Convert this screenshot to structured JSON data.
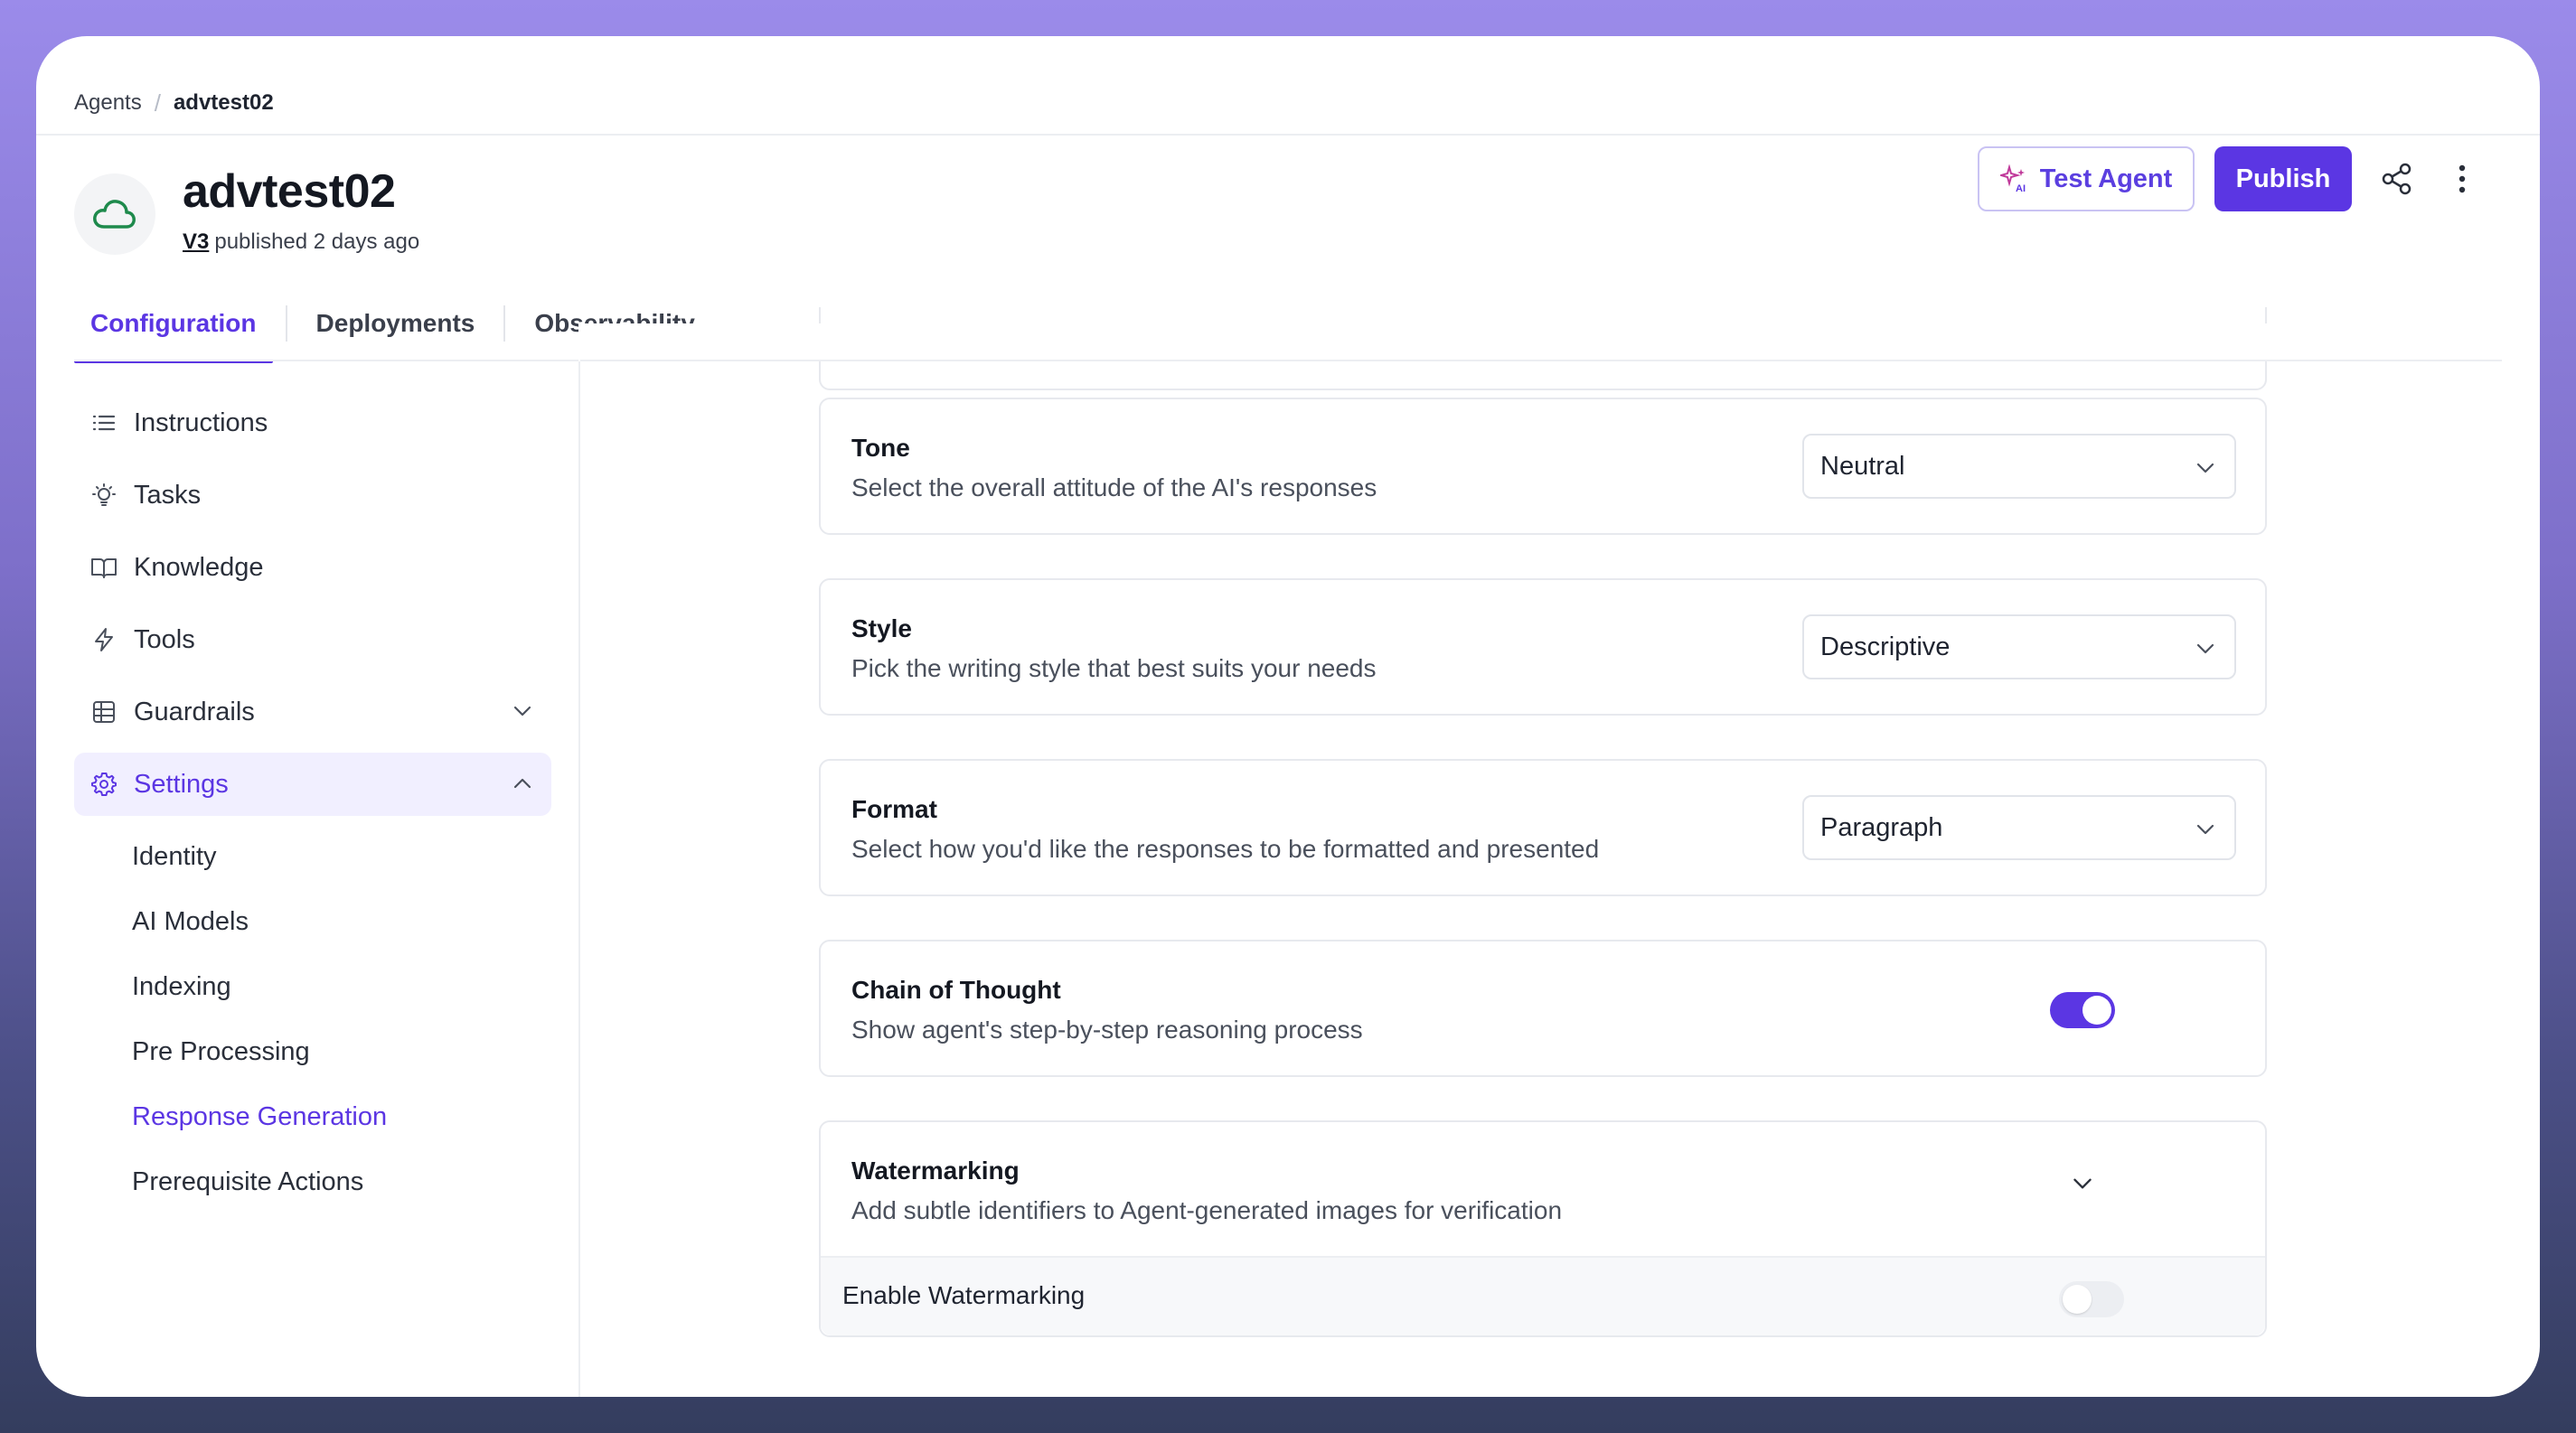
{
  "breadcrumb": {
    "root": "Agents",
    "separator": "/",
    "current": "advtest02"
  },
  "agent": {
    "name": "advtest02",
    "version": "V3",
    "status_text": "published 2 days ago",
    "icon": "cloud-icon"
  },
  "actions": {
    "test_label": "Test Agent",
    "publish_label": "Publish"
  },
  "tabs": [
    {
      "label": "Configuration",
      "active": true
    },
    {
      "label": "Deployments",
      "active": false
    },
    {
      "label": "Observability",
      "active": false
    }
  ],
  "sidebar": {
    "items": [
      {
        "label": "Instructions",
        "icon": "list-icon"
      },
      {
        "label": "Tasks",
        "icon": "lightbulb-icon"
      },
      {
        "label": "Knowledge",
        "icon": "book-icon"
      },
      {
        "label": "Tools",
        "icon": "bolt-icon"
      },
      {
        "label": "Guardrails",
        "icon": "grid-icon"
      },
      {
        "label": "Settings",
        "icon": "gear-icon"
      }
    ],
    "settings_sub": [
      {
        "label": "Identity"
      },
      {
        "label": "AI Models"
      },
      {
        "label": "Indexing"
      },
      {
        "label": "Pre Processing"
      },
      {
        "label": "Response Generation"
      },
      {
        "label": "Prerequisite Actions"
      }
    ]
  },
  "settings": {
    "tone": {
      "title": "Tone",
      "description": "Select the overall attitude of the AI's responses",
      "value": "Neutral"
    },
    "style": {
      "title": "Style",
      "description": "Pick the writing style that best suits your needs",
      "value": "Descriptive"
    },
    "format": {
      "title": "Format",
      "description": "Select how you'd like the responses to be formatted and presented",
      "value": "Paragraph"
    },
    "chain_of_thought": {
      "title": "Chain of Thought",
      "description": "Show agent's step-by-step reasoning process",
      "enabled": true
    },
    "watermarking": {
      "title": "Watermarking",
      "description": "Add subtle identifiers to Agent-generated images for verification",
      "enable_label": "Enable Watermarking",
      "enabled": false
    }
  },
  "colors": {
    "accent": "#5b36e3",
    "accent_light": "#f1efff",
    "cloud_green": "#1e8a4c"
  }
}
